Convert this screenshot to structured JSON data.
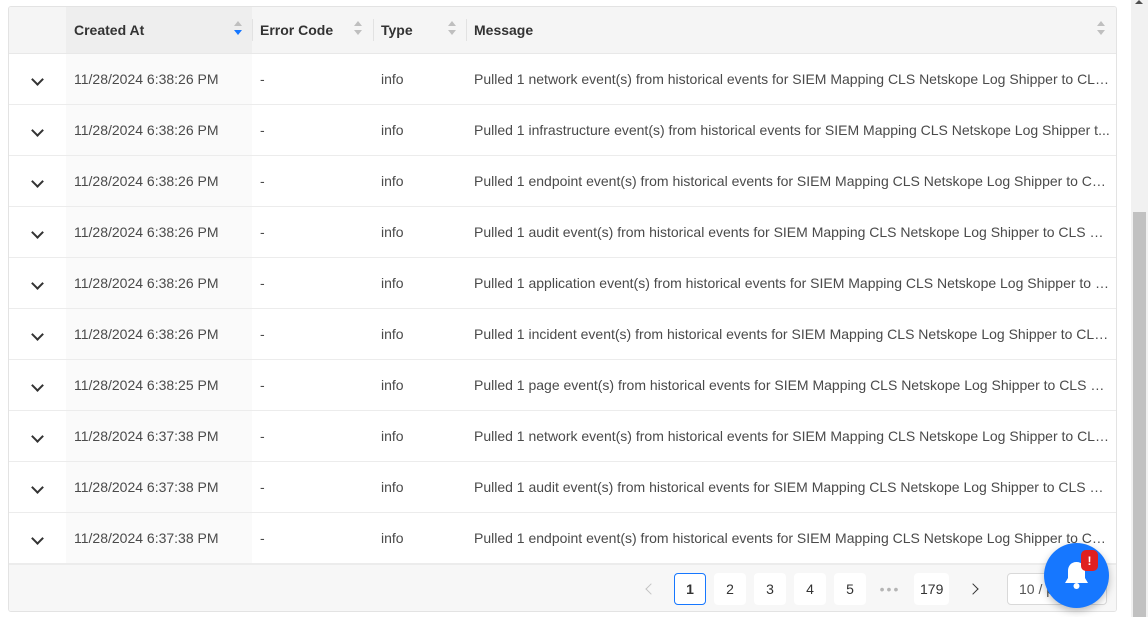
{
  "table": {
    "columns": [
      {
        "key": "expand",
        "label": ""
      },
      {
        "key": "created_at",
        "label": "Created At"
      },
      {
        "key": "error_code",
        "label": "Error Code"
      },
      {
        "key": "type",
        "label": "Type"
      },
      {
        "key": "message",
        "label": "Message"
      }
    ],
    "sort": {
      "column": "created_at",
      "direction": "descending"
    },
    "rows": [
      {
        "created_at": "11/28/2024 6:38:26 PM",
        "error_code": "-",
        "type": "info",
        "message": "Pulled 1 network event(s) from historical events for SIEM Mapping CLS Netskope Log Shipper to CLS ..."
      },
      {
        "created_at": "11/28/2024 6:38:26 PM",
        "error_code": "-",
        "type": "info",
        "message": "Pulled 1 infrastructure event(s) from historical events for SIEM Mapping CLS Netskope Log Shipper t..."
      },
      {
        "created_at": "11/28/2024 6:38:26 PM",
        "error_code": "-",
        "type": "info",
        "message": "Pulled 1 endpoint event(s) from historical events for SIEM Mapping CLS Netskope Log Shipper to CL..."
      },
      {
        "created_at": "11/28/2024 6:38:26 PM",
        "error_code": "-",
        "type": "info",
        "message": "Pulled 1 audit event(s) from historical events for SIEM Mapping CLS Netskope Log Shipper to CLS Sc..."
      },
      {
        "created_at": "11/28/2024 6:38:26 PM",
        "error_code": "-",
        "type": "info",
        "message": "Pulled 1 application event(s) from historical events for SIEM Mapping CLS Netskope Log Shipper to C..."
      },
      {
        "created_at": "11/28/2024 6:38:26 PM",
        "error_code": "-",
        "type": "info",
        "message": "Pulled 1 incident event(s) from historical events for SIEM Mapping CLS Netskope Log Shipper to CLS ..."
      },
      {
        "created_at": "11/28/2024 6:38:25 PM",
        "error_code": "-",
        "type": "info",
        "message": "Pulled 1 page event(s) from historical events for SIEM Mapping CLS Netskope Log Shipper to CLS Sc..."
      },
      {
        "created_at": "11/28/2024 6:37:38 PM",
        "error_code": "-",
        "type": "info",
        "message": "Pulled 1 network event(s) from historical events for SIEM Mapping CLS Netskope Log Shipper to CLS ..."
      },
      {
        "created_at": "11/28/2024 6:37:38 PM",
        "error_code": "-",
        "type": "info",
        "message": "Pulled 1 audit event(s) from historical events for SIEM Mapping CLS Netskope Log Shipper to CLS Sc..."
      },
      {
        "created_at": "11/28/2024 6:37:38 PM",
        "error_code": "-",
        "type": "info",
        "message": "Pulled 1 endpoint event(s) from historical events for SIEM Mapping CLS Netskope Log Shipper to CL..."
      }
    ]
  },
  "pagination": {
    "current": "1",
    "pages": [
      "1",
      "2",
      "3",
      "4",
      "5"
    ],
    "ellipsis": "•••",
    "last": "179",
    "page_size_label": "10 / p"
  },
  "notification": {
    "badge": "!",
    "icon": "bell-icon",
    "accent_color": "#1677ff",
    "badge_color": "#e02020"
  }
}
